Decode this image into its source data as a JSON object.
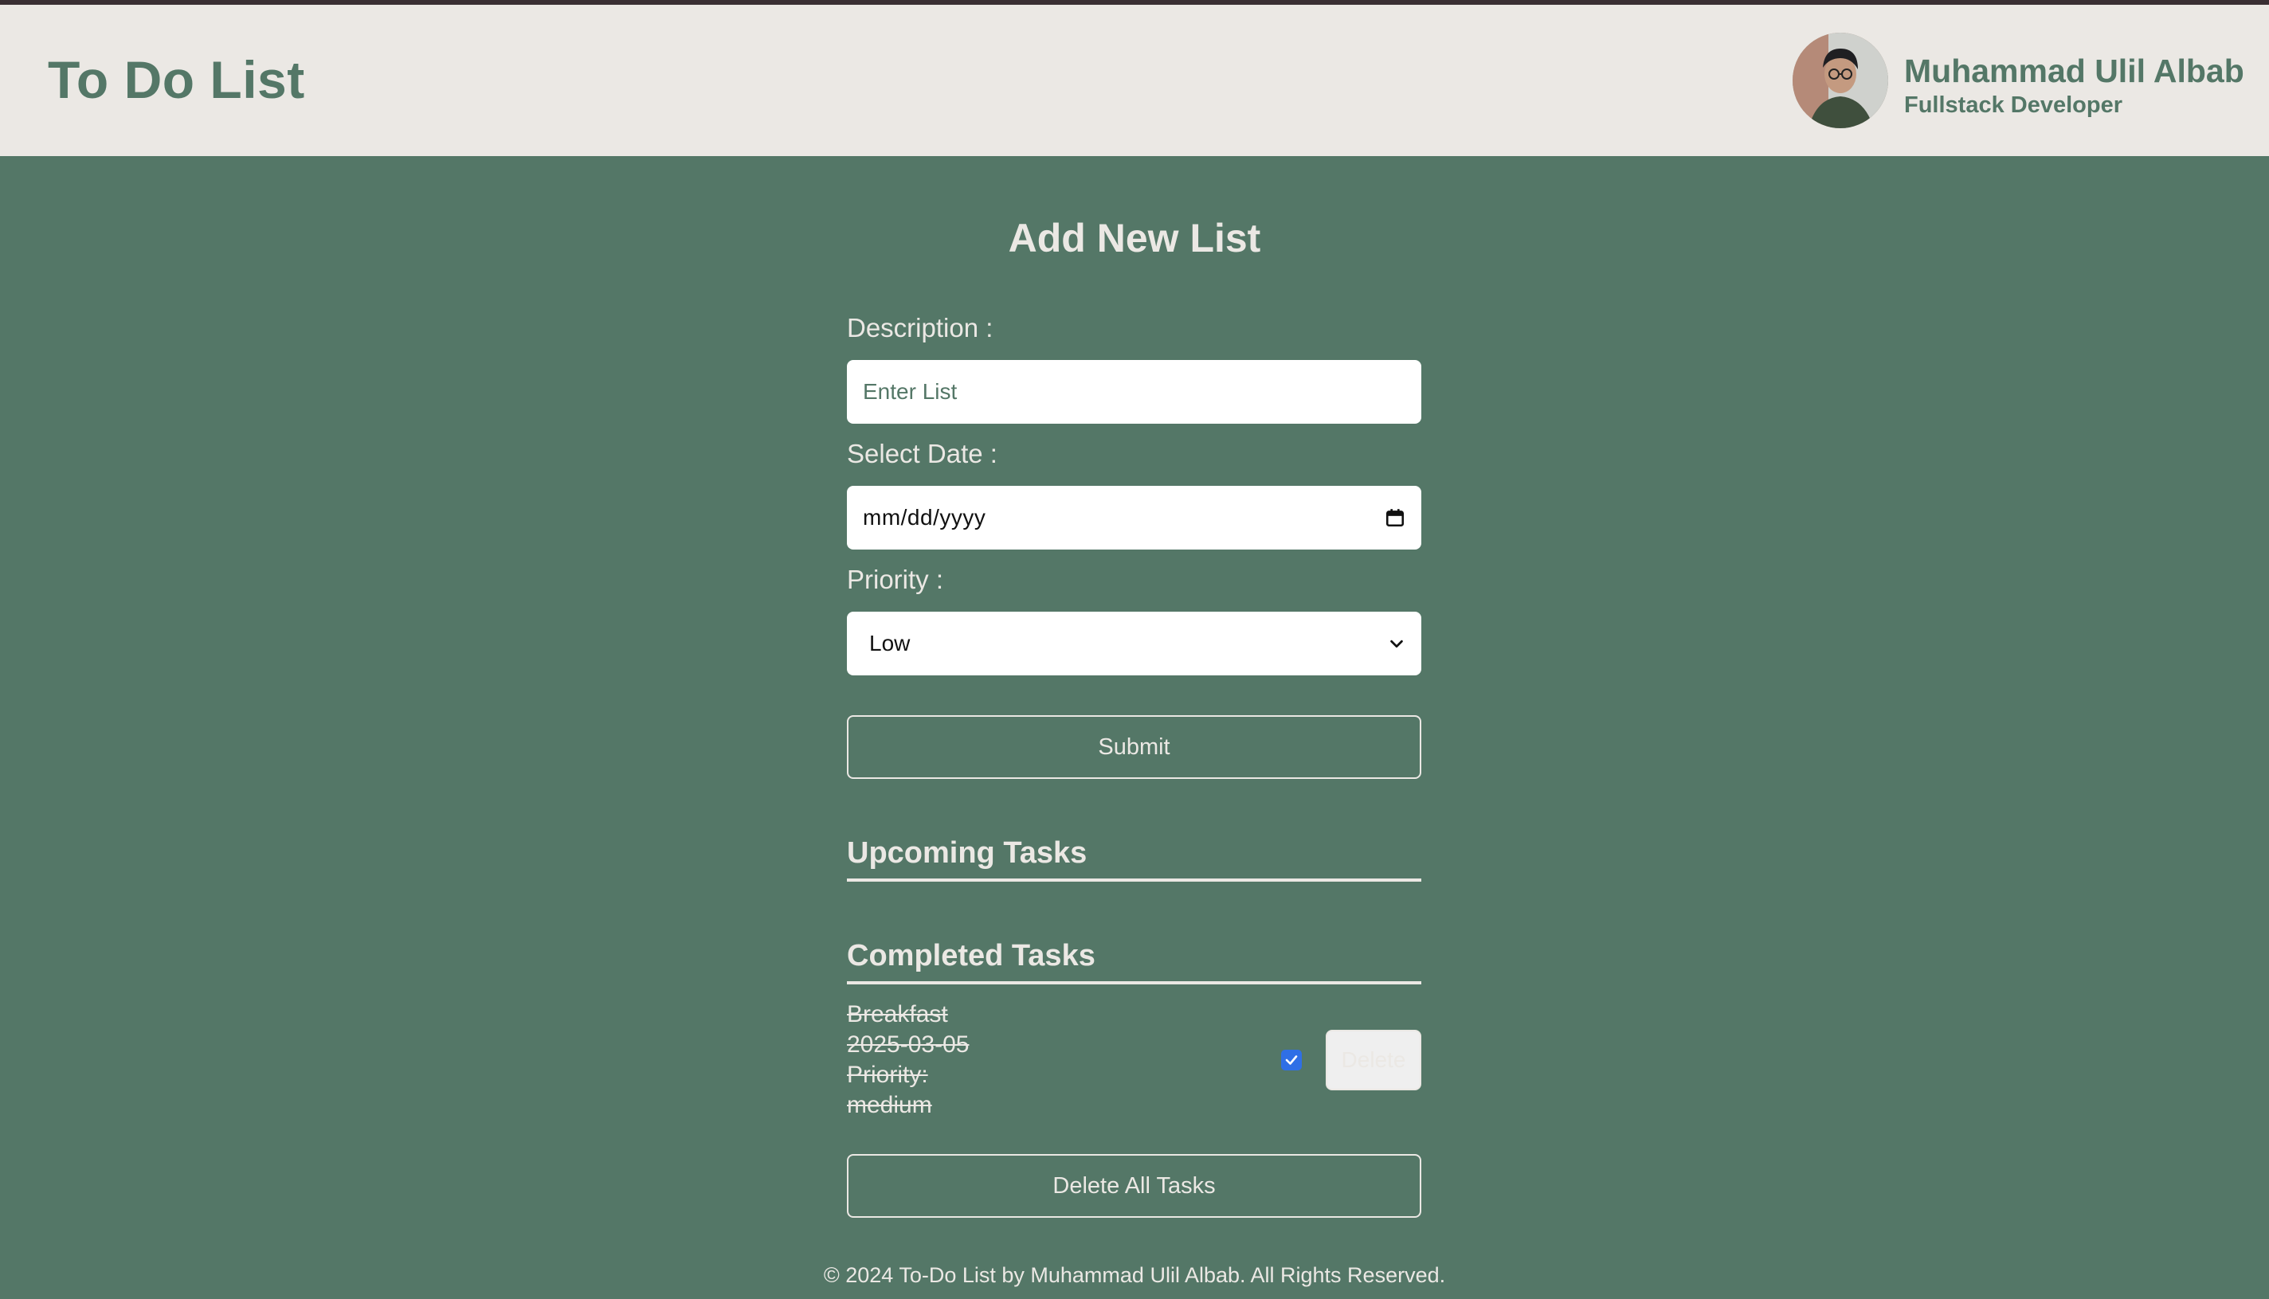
{
  "header": {
    "app_title": "To Do List",
    "user": {
      "name": "Muhammad Ulil Albab",
      "role": "Fullstack Developer"
    }
  },
  "form": {
    "title": "Add New List",
    "description_label": "Description :",
    "description_placeholder": "Enter List",
    "date_label": "Select Date :",
    "date_placeholder": "mm/dd/yyyy",
    "priority_label": "Priority :",
    "priority_value": "Low",
    "submit_label": "Submit"
  },
  "upcoming": {
    "title": "Upcoming Tasks",
    "items": []
  },
  "completed": {
    "title": "Completed Tasks",
    "items": [
      {
        "name": "Breakfast",
        "date": "2025-03-05",
        "priority_label": "Priority:",
        "priority": "medium",
        "checked": true,
        "delete_label": "Delete"
      }
    ]
  },
  "delete_all_label": "Delete All Tasks",
  "footer": {
    "text": "© 2024 To-Do List by Muhammad Ulil Albab. All Rights Reserved."
  },
  "colors": {
    "background": "#547767",
    "header_bg": "#ebe8e4",
    "accent_text": "#547767",
    "light_text": "#ebe8e4",
    "checkbox": "#2f6fe6"
  },
  "icons": {
    "calendar": "calendar-icon",
    "select_chevron": "chevron-down-icon",
    "checkbox": "check-icon"
  }
}
